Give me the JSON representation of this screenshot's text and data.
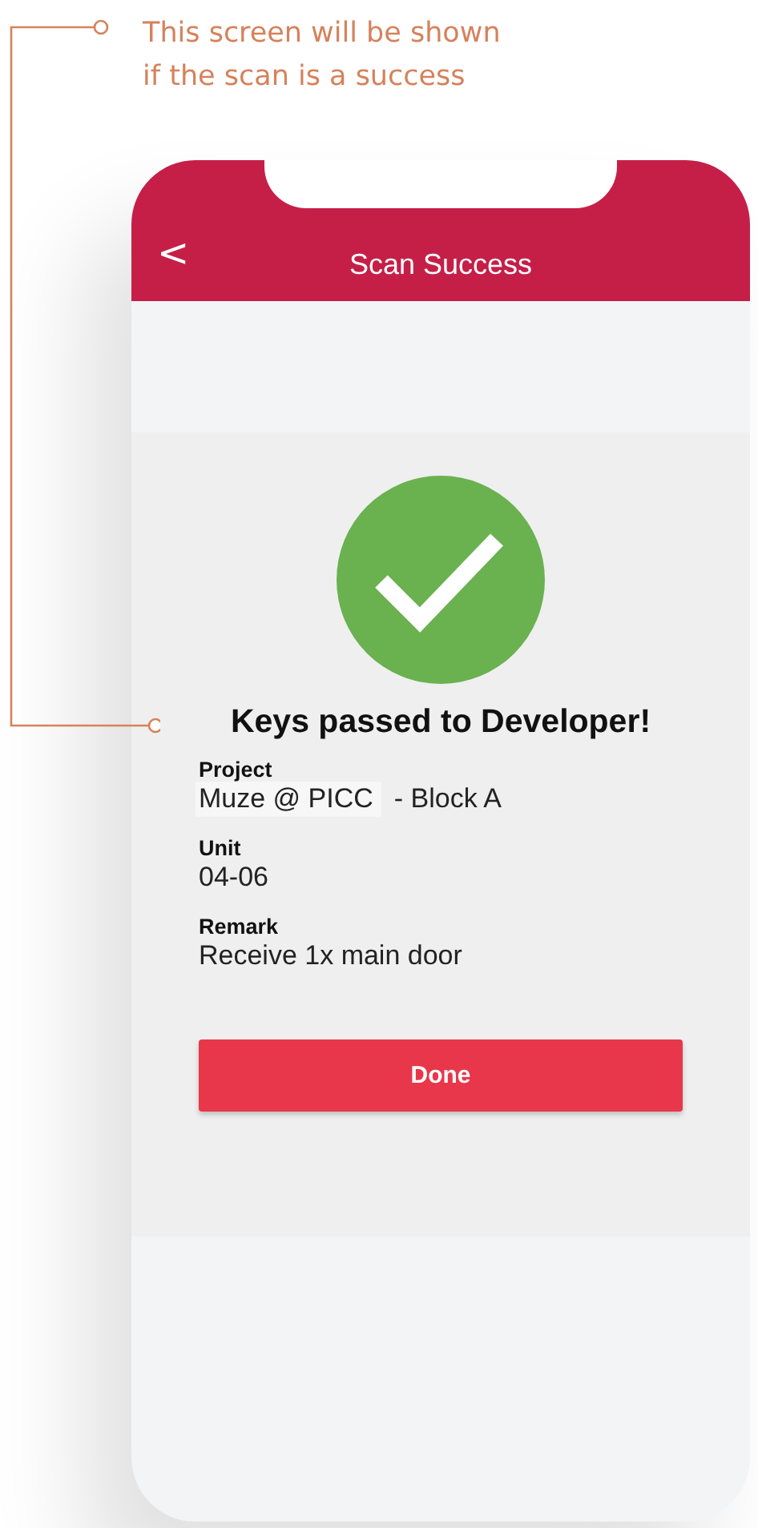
{
  "annotation": {
    "lines": [
      "This screen will be shown",
      "if the scan is a success"
    ]
  },
  "header": {
    "back": "<",
    "title": "Scan Success"
  },
  "result": {
    "title": "Keys passed to Developer!"
  },
  "fields": [
    {
      "label": "Project",
      "value": "Muze @ PICC",
      "suffix": "- Block A"
    },
    {
      "label": "Unit",
      "value": "04-06"
    },
    {
      "label": "Remark",
      "value": "Receive 1x main door"
    }
  ],
  "button": "Done"
}
